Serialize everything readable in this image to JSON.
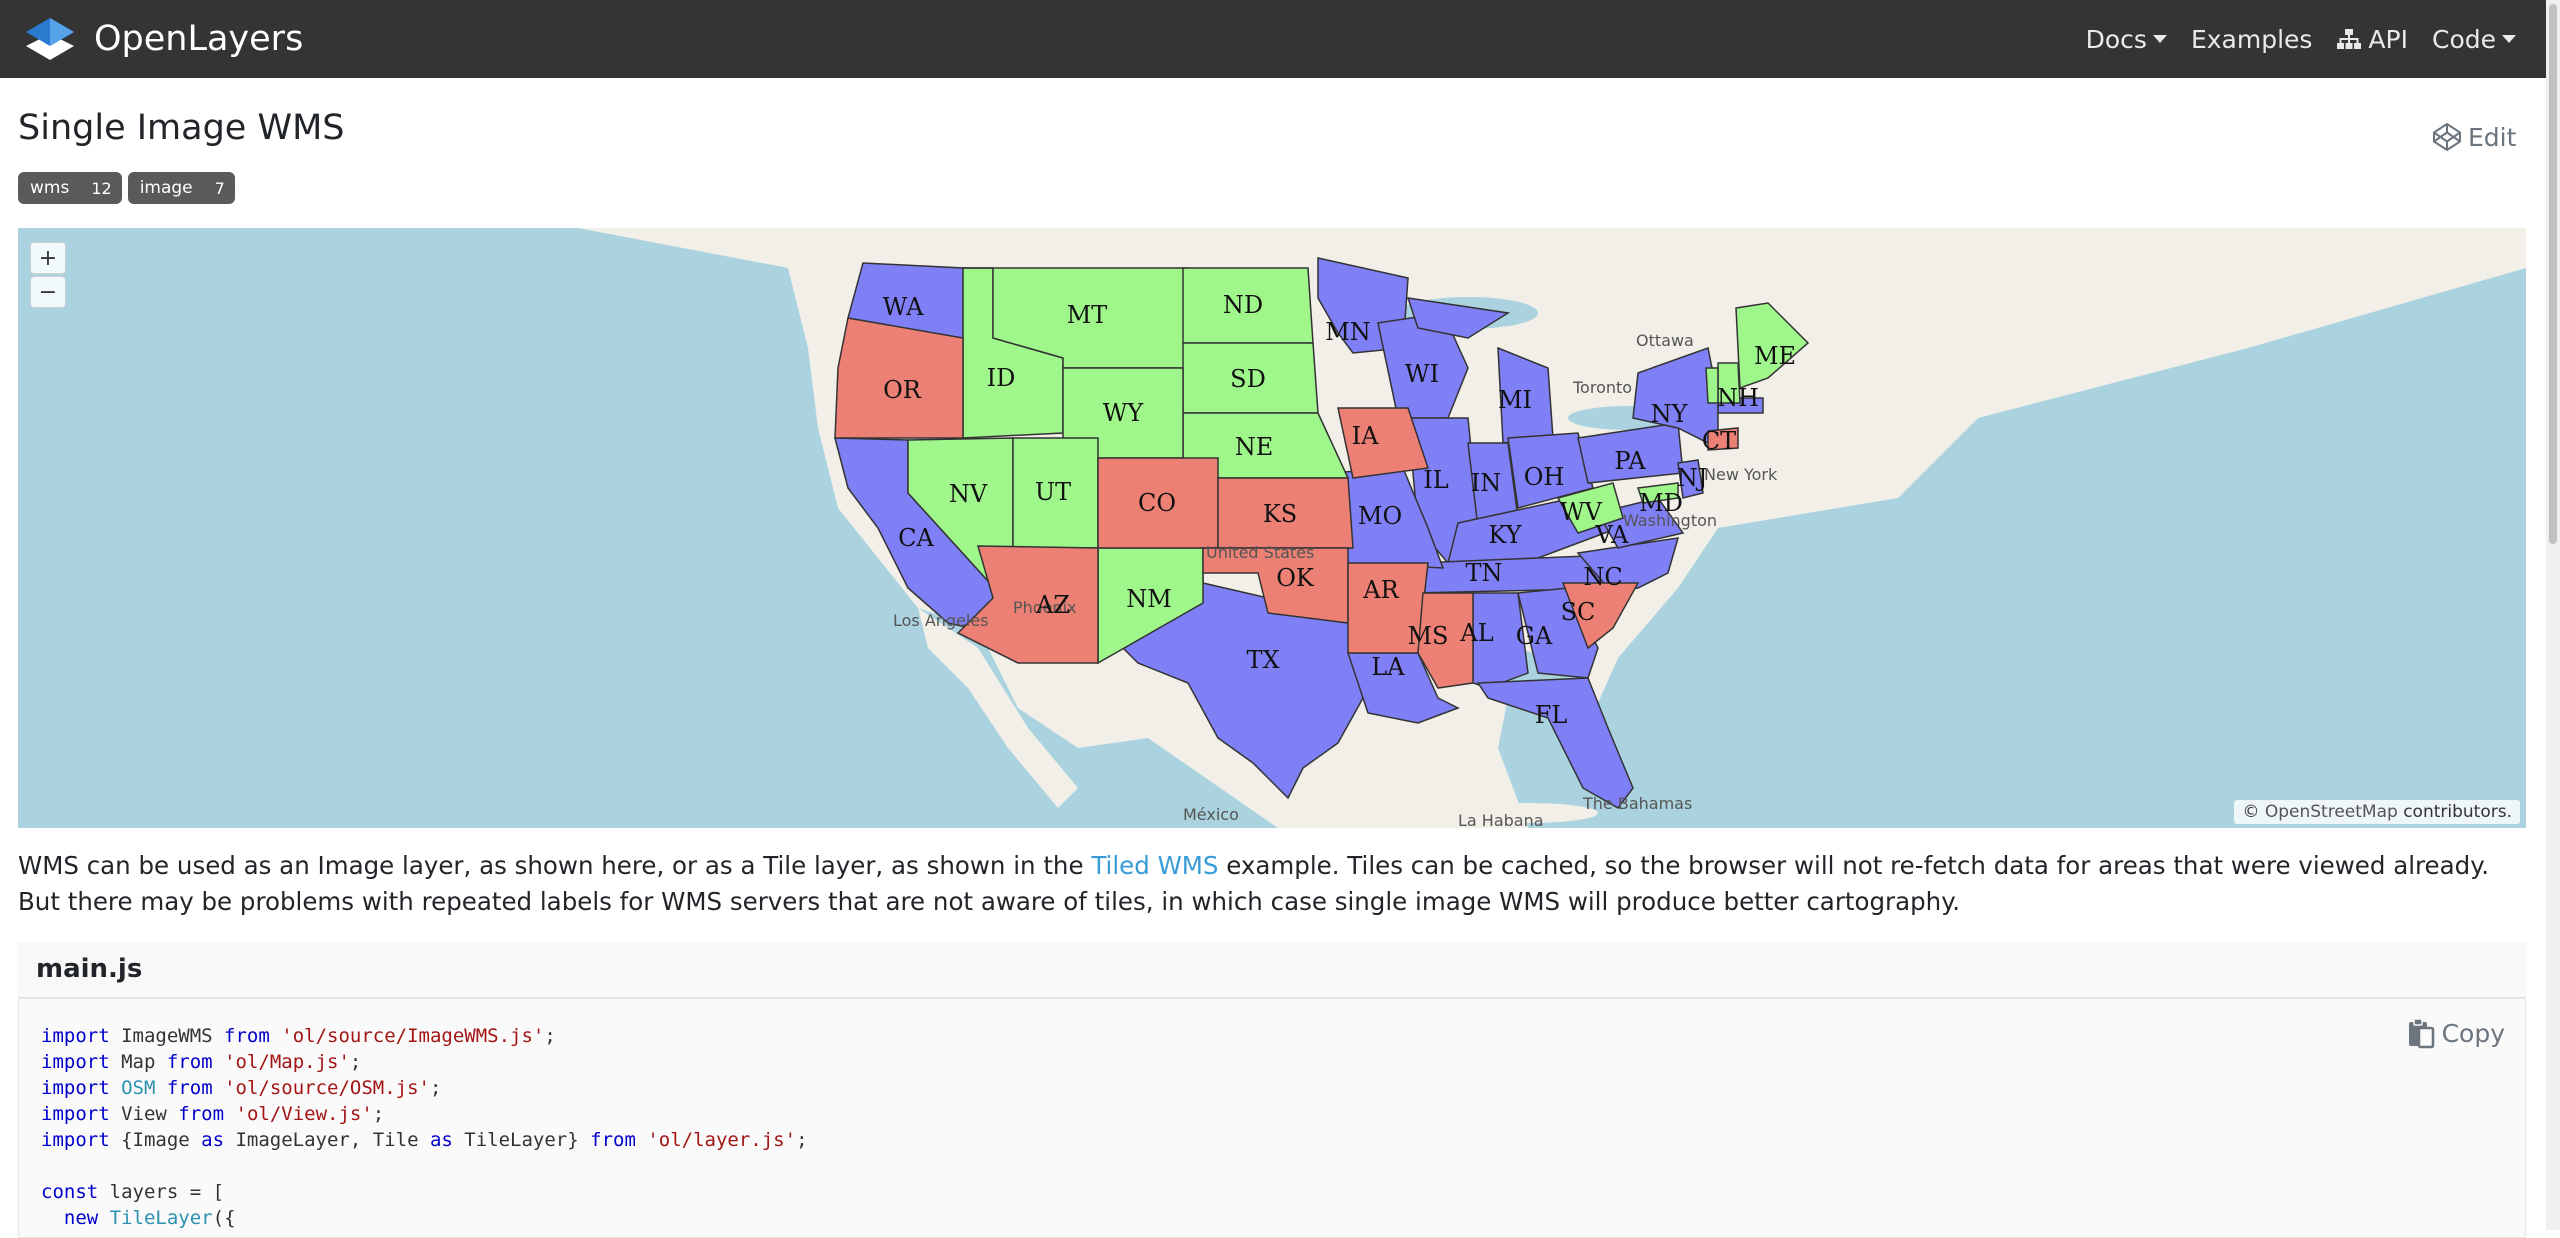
{
  "navbar": {
    "brand": "OpenLayers",
    "items": [
      {
        "label": "Docs",
        "has_caret": true
      },
      {
        "label": "Examples",
        "has_caret": false
      },
      {
        "label": "API",
        "icon": "sitemap-icon",
        "has_caret": false
      },
      {
        "label": "Code",
        "has_caret": true
      }
    ]
  },
  "page": {
    "title": "Single Image WMS",
    "tags": [
      {
        "label": "wms",
        "count": "12"
      },
      {
        "label": "image",
        "count": "7"
      }
    ],
    "edit_label": "Edit"
  },
  "map": {
    "zoom_in": "+",
    "zoom_out": "−",
    "attribution_prefix": "©",
    "attribution_link": "OpenStreetMap",
    "attribution_suffix": "contributors.",
    "state_labels": [
      "WA",
      "OR",
      "CA",
      "ID",
      "NV",
      "MT",
      "WY",
      "UT",
      "AZ",
      "ND",
      "SD",
      "NE",
      "CO",
      "NM",
      "KS",
      "OK",
      "TX",
      "MN",
      "IA",
      "MO",
      "AR",
      "LA",
      "WI",
      "IL",
      "MI",
      "IN",
      "OH",
      "KY",
      "TN",
      "MS",
      "AL",
      "GA",
      "FL",
      "SC",
      "NC",
      "VA",
      "WV",
      "PA",
      "NY",
      "MD",
      "NJ",
      "CT",
      "NH",
      "ME"
    ],
    "place_labels": [
      "Ottawa",
      "Toronto",
      "Los Angeles",
      "Phoenix",
      "United States",
      "México",
      "La Habana",
      "The Bahamas",
      "New York",
      "Washington"
    ],
    "colors": {
      "low": "#9ff68a",
      "mid": "#7f7ff6",
      "high": "#ec8074",
      "water": "#aad3df",
      "land": "#f2efe9"
    }
  },
  "description": {
    "before_link": "WMS can be used as an Image layer, as shown here, or as a Tile layer, as shown in the ",
    "link": "Tiled WMS",
    "after_link": " example. Tiles can be cached, so the browser will not re-fetch data for areas that were viewed already. But there may be problems with repeated labels for WMS servers that are not aware of tiles, in which case single image WMS will produce better cartography."
  },
  "code_panel": {
    "filename": "main.js",
    "copy_label": "Copy",
    "lines": [
      "import ImageWMS from 'ol/source/ImageWMS.js';",
      "import Map from 'ol/Map.js';",
      "import OSM from 'ol/source/OSM.js';",
      "import View from 'ol/View.js';",
      "import {Image as ImageLayer, Tile as TileLayer} from 'ol/layer.js';",
      "",
      "const layers = [",
      "  new TileLayer({"
    ]
  }
}
